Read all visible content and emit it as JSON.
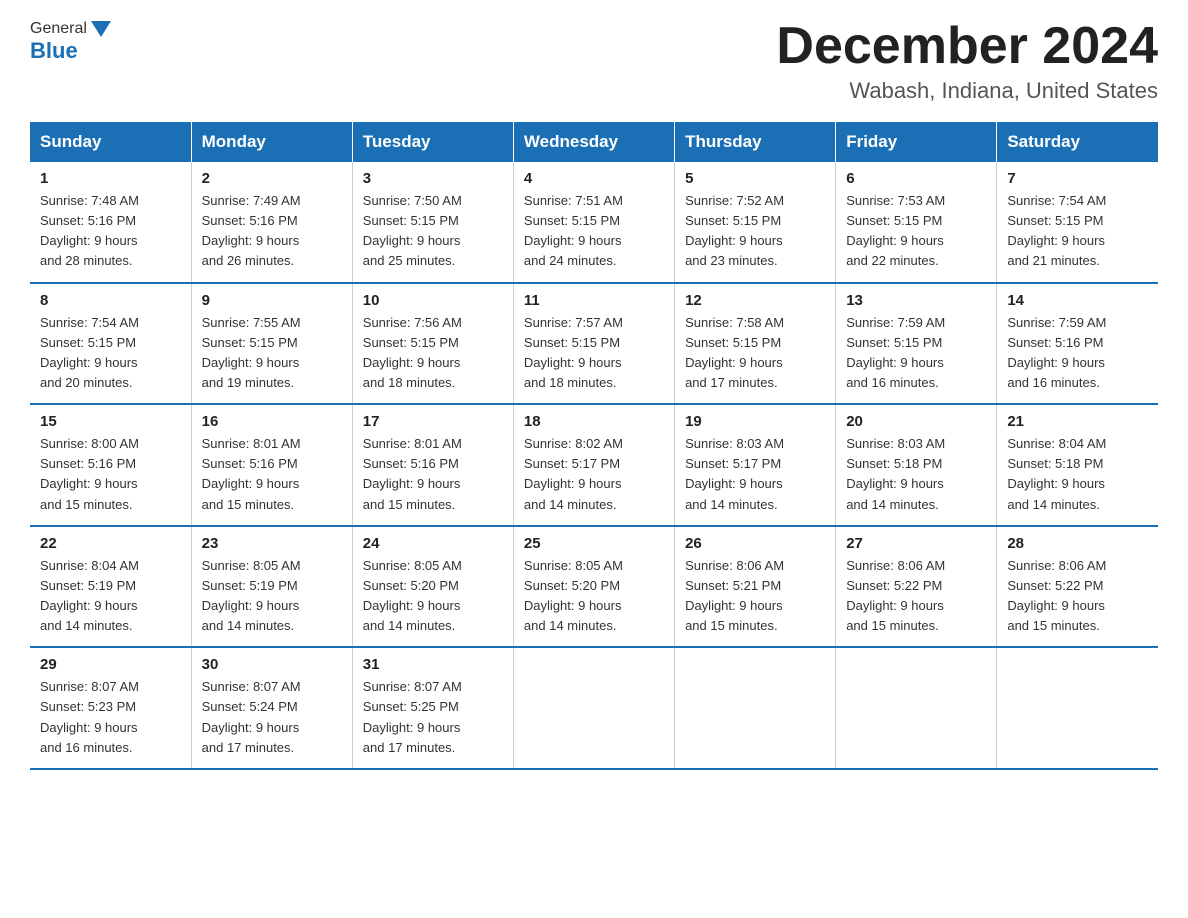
{
  "header": {
    "logo_general": "General",
    "logo_blue": "Blue",
    "month_title": "December 2024",
    "location": "Wabash, Indiana, United States"
  },
  "days_of_week": [
    "Sunday",
    "Monday",
    "Tuesday",
    "Wednesday",
    "Thursday",
    "Friday",
    "Saturday"
  ],
  "weeks": [
    [
      {
        "day": "1",
        "sunrise": "7:48 AM",
        "sunset": "5:16 PM",
        "daylight": "9 hours and 28 minutes."
      },
      {
        "day": "2",
        "sunrise": "7:49 AM",
        "sunset": "5:16 PM",
        "daylight": "9 hours and 26 minutes."
      },
      {
        "day": "3",
        "sunrise": "7:50 AM",
        "sunset": "5:15 PM",
        "daylight": "9 hours and 25 minutes."
      },
      {
        "day": "4",
        "sunrise": "7:51 AM",
        "sunset": "5:15 PM",
        "daylight": "9 hours and 24 minutes."
      },
      {
        "day": "5",
        "sunrise": "7:52 AM",
        "sunset": "5:15 PM",
        "daylight": "9 hours and 23 minutes."
      },
      {
        "day": "6",
        "sunrise": "7:53 AM",
        "sunset": "5:15 PM",
        "daylight": "9 hours and 22 minutes."
      },
      {
        "day": "7",
        "sunrise": "7:54 AM",
        "sunset": "5:15 PM",
        "daylight": "9 hours and 21 minutes."
      }
    ],
    [
      {
        "day": "8",
        "sunrise": "7:54 AM",
        "sunset": "5:15 PM",
        "daylight": "9 hours and 20 minutes."
      },
      {
        "day": "9",
        "sunrise": "7:55 AM",
        "sunset": "5:15 PM",
        "daylight": "9 hours and 19 minutes."
      },
      {
        "day": "10",
        "sunrise": "7:56 AM",
        "sunset": "5:15 PM",
        "daylight": "9 hours and 18 minutes."
      },
      {
        "day": "11",
        "sunrise": "7:57 AM",
        "sunset": "5:15 PM",
        "daylight": "9 hours and 18 minutes."
      },
      {
        "day": "12",
        "sunrise": "7:58 AM",
        "sunset": "5:15 PM",
        "daylight": "9 hours and 17 minutes."
      },
      {
        "day": "13",
        "sunrise": "7:59 AM",
        "sunset": "5:15 PM",
        "daylight": "9 hours and 16 minutes."
      },
      {
        "day": "14",
        "sunrise": "7:59 AM",
        "sunset": "5:16 PM",
        "daylight": "9 hours and 16 minutes."
      }
    ],
    [
      {
        "day": "15",
        "sunrise": "8:00 AM",
        "sunset": "5:16 PM",
        "daylight": "9 hours and 15 minutes."
      },
      {
        "day": "16",
        "sunrise": "8:01 AM",
        "sunset": "5:16 PM",
        "daylight": "9 hours and 15 minutes."
      },
      {
        "day": "17",
        "sunrise": "8:01 AM",
        "sunset": "5:16 PM",
        "daylight": "9 hours and 15 minutes."
      },
      {
        "day": "18",
        "sunrise": "8:02 AM",
        "sunset": "5:17 PM",
        "daylight": "9 hours and 14 minutes."
      },
      {
        "day": "19",
        "sunrise": "8:03 AM",
        "sunset": "5:17 PM",
        "daylight": "9 hours and 14 minutes."
      },
      {
        "day": "20",
        "sunrise": "8:03 AM",
        "sunset": "5:18 PM",
        "daylight": "9 hours and 14 minutes."
      },
      {
        "day": "21",
        "sunrise": "8:04 AM",
        "sunset": "5:18 PM",
        "daylight": "9 hours and 14 minutes."
      }
    ],
    [
      {
        "day": "22",
        "sunrise": "8:04 AM",
        "sunset": "5:19 PM",
        "daylight": "9 hours and 14 minutes."
      },
      {
        "day": "23",
        "sunrise": "8:05 AM",
        "sunset": "5:19 PM",
        "daylight": "9 hours and 14 minutes."
      },
      {
        "day": "24",
        "sunrise": "8:05 AM",
        "sunset": "5:20 PM",
        "daylight": "9 hours and 14 minutes."
      },
      {
        "day": "25",
        "sunrise": "8:05 AM",
        "sunset": "5:20 PM",
        "daylight": "9 hours and 14 minutes."
      },
      {
        "day": "26",
        "sunrise": "8:06 AM",
        "sunset": "5:21 PM",
        "daylight": "9 hours and 15 minutes."
      },
      {
        "day": "27",
        "sunrise": "8:06 AM",
        "sunset": "5:22 PM",
        "daylight": "9 hours and 15 minutes."
      },
      {
        "day": "28",
        "sunrise": "8:06 AM",
        "sunset": "5:22 PM",
        "daylight": "9 hours and 15 minutes."
      }
    ],
    [
      {
        "day": "29",
        "sunrise": "8:07 AM",
        "sunset": "5:23 PM",
        "daylight": "9 hours and 16 minutes."
      },
      {
        "day": "30",
        "sunrise": "8:07 AM",
        "sunset": "5:24 PM",
        "daylight": "9 hours and 17 minutes."
      },
      {
        "day": "31",
        "sunrise": "8:07 AM",
        "sunset": "5:25 PM",
        "daylight": "9 hours and 17 minutes."
      },
      null,
      null,
      null,
      null
    ]
  ],
  "labels": {
    "sunrise_prefix": "Sunrise: ",
    "sunset_prefix": "Sunset: ",
    "daylight_prefix": "Daylight: "
  }
}
